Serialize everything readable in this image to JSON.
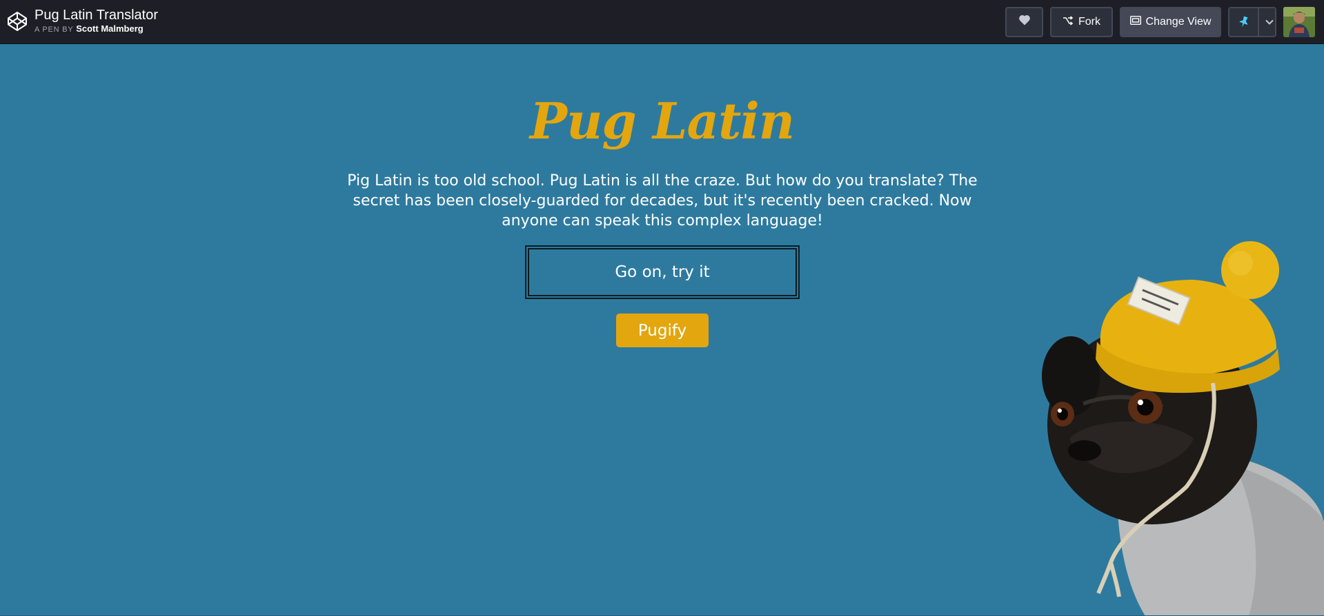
{
  "header": {
    "pen_title": "Pug Latin Translator",
    "pen_by_prefix": "A PEN BY",
    "author": "Scott Malmberg",
    "fork_label": "Fork",
    "change_view_label": "Change View",
    "icons": [
      "codepen-logo-icon",
      "heart-icon",
      "fork-icon",
      "change-view-icon",
      "pin-icon",
      "chevron-down-icon"
    ]
  },
  "main": {
    "title": "Pug Latin",
    "description": "Pig Latin is too old school. Pug Latin is all the craze. But how do you translate? The secret has been closely-guarded for decades, but it's recently been cracked. Now anyone can speak this complex language!",
    "input_placeholder": "Go on, try it",
    "button_label": "Pugify"
  },
  "colors": {
    "background": "#2e7a9e",
    "topbar": "#1e1f26",
    "accent": "#e3a60f",
    "pin": "#47cfff"
  }
}
